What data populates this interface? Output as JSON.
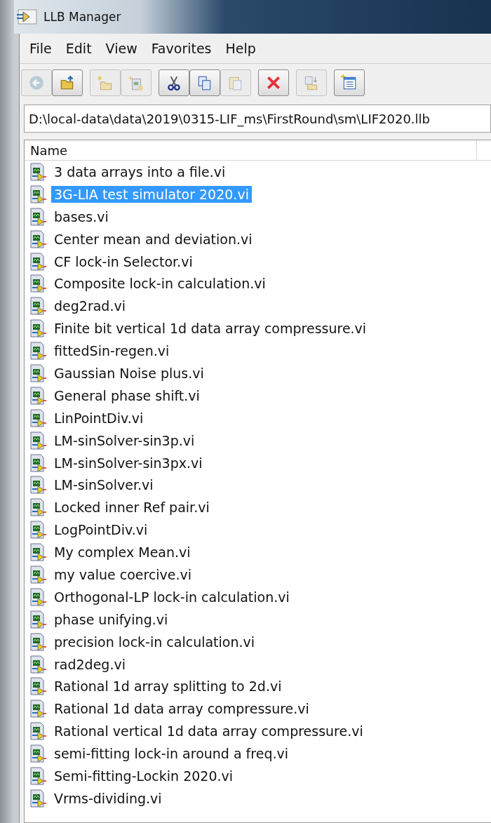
{
  "window": {
    "title": "LLB Manager"
  },
  "menu": [
    "File",
    "Edit",
    "View",
    "Favorites",
    "Help"
  ],
  "toolbar": [
    {
      "kind": "back",
      "disabled": true
    },
    {
      "kind": "open",
      "disabled": false
    },
    {
      "kind": "newfolder",
      "disabled": true
    },
    {
      "kind": "newvi",
      "disabled": true
    },
    {
      "kind": "cut",
      "disabled": false
    },
    {
      "kind": "copy",
      "disabled": false
    },
    {
      "kind": "paste",
      "disabled": true
    },
    {
      "kind": "delete",
      "disabled": false
    },
    {
      "kind": "move",
      "disabled": true
    },
    {
      "kind": "properties",
      "disabled": false
    }
  ],
  "path": "D:\\local-data\\data\\2019\\0315-LIF_ms\\FirstRound\\sm\\LIF2020.llb",
  "table": {
    "columns": [
      "Name"
    ],
    "rows": [
      {
        "name": "3 data arrays into a file.vi",
        "selected": false
      },
      {
        "name": "3G-LIA test simulator 2020.vi",
        "selected": true
      },
      {
        "name": "bases.vi",
        "selected": false
      },
      {
        "name": "Center mean and deviation.vi",
        "selected": false
      },
      {
        "name": "CF lock-in Selector.vi",
        "selected": false
      },
      {
        "name": "Composite lock-in calculation.vi",
        "selected": false
      },
      {
        "name": "deg2rad.vi",
        "selected": false
      },
      {
        "name": "Finite bit vertical 1d data array compressure.vi",
        "selected": false
      },
      {
        "name": "fittedSin-regen.vi",
        "selected": false
      },
      {
        "name": "Gaussian Noise plus.vi",
        "selected": false
      },
      {
        "name": "General phase shift.vi",
        "selected": false
      },
      {
        "name": "LinPointDiv.vi",
        "selected": false
      },
      {
        "name": "LM-sinSolver-sin3p.vi",
        "selected": false
      },
      {
        "name": "LM-sinSolver-sin3px.vi",
        "selected": false
      },
      {
        "name": "LM-sinSolver.vi",
        "selected": false
      },
      {
        "name": "Locked inner Ref pair.vi",
        "selected": false
      },
      {
        "name": "LogPointDiv.vi",
        "selected": false
      },
      {
        "name": "My complex Mean.vi",
        "selected": false
      },
      {
        "name": "my value coercive.vi",
        "selected": false
      },
      {
        "name": "Orthogonal-LP lock-in calculation.vi",
        "selected": false
      },
      {
        "name": "phase unifying.vi",
        "selected": false
      },
      {
        "name": "precision lock-in calculation.vi",
        "selected": false
      },
      {
        "name": "rad2deg.vi",
        "selected": false
      },
      {
        "name": "Rational 1d array splitting to 2d.vi",
        "selected": false
      },
      {
        "name": "Rational 1d data array compressure.vi",
        "selected": false
      },
      {
        "name": "Rational vertical 1d data array compressure.vi",
        "selected": false
      },
      {
        "name": "semi-fitting lock-in around a freq.vi",
        "selected": false
      },
      {
        "name": "Semi-fitting-Lockin 2020.vi",
        "selected": false
      },
      {
        "name": "Vrms-dividing.vi",
        "selected": false
      }
    ]
  }
}
